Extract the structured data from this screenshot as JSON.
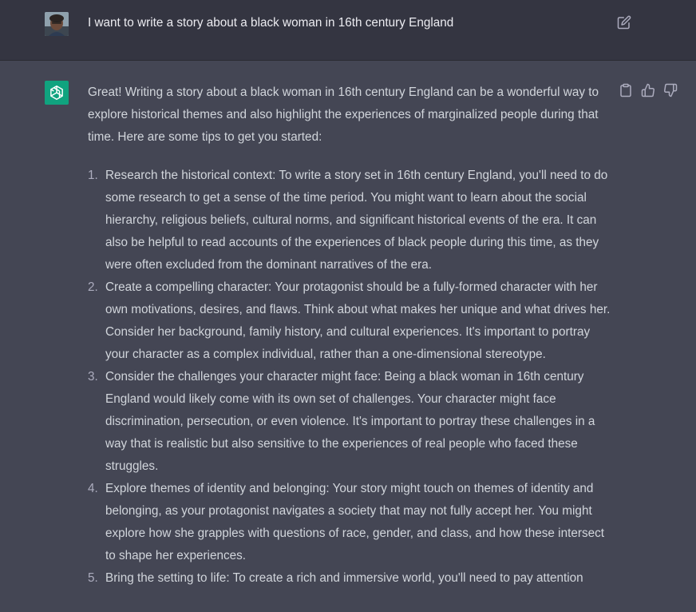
{
  "conversation": {
    "user_message": "I want to write a story about a black woman in 16th century England",
    "assistant_intro": "Great! Writing a story about a black woman in 16th century England can be a wonderful way to explore historical themes and also highlight the experiences of marginalized people during that time. Here are some tips to get you started:",
    "tips": [
      {
        "number": "1.",
        "text": "Research the historical context: To write a story set in 16th century England, you'll need to do some research to get a sense of the time period. You might want to learn about the social hierarchy, religious beliefs, cultural norms, and significant historical events of the era. It can also be helpful to read accounts of the experiences of black people during this time, as they were often excluded from the dominant narratives of the era."
      },
      {
        "number": "2.",
        "text": "Create a compelling character: Your protagonist should be a fully-formed character with her own motivations, desires, and flaws. Think about what makes her unique and what drives her. Consider her background, family history, and cultural experiences. It's important to portray your character as a complex individual, rather than a one-dimensional stereotype."
      },
      {
        "number": "3.",
        "text": "Consider the challenges your character might face: Being a black woman in 16th century England would likely come with its own set of challenges. Your character might face discrimination, persecution, or even violence. It's important to portray these challenges in a way that is realistic but also sensitive to the experiences of real people who faced these struggles."
      },
      {
        "number": "4.",
        "text": "Explore themes of identity and belonging: Your story might touch on themes of identity and belonging, as your protagonist navigates a society that may not fully accept her. You might explore how she grapples with questions of race, gender, and class, and how these intersect to shape her experiences."
      },
      {
        "number": "5.",
        "text": "Bring the setting to life: To create a rich and immersive world, you'll need to pay attention"
      }
    ]
  },
  "icons": {
    "edit": "edit-icon",
    "copy": "clipboard-icon",
    "thumbs_up": "thumbs-up-icon",
    "thumbs_down": "thumbs-down-icon",
    "assistant_logo": "openai-logo-icon"
  },
  "colors": {
    "user_bg": "#343541",
    "assistant_bg": "#444654",
    "assistant_avatar": "#10a37f",
    "text": "#d1d5db"
  }
}
